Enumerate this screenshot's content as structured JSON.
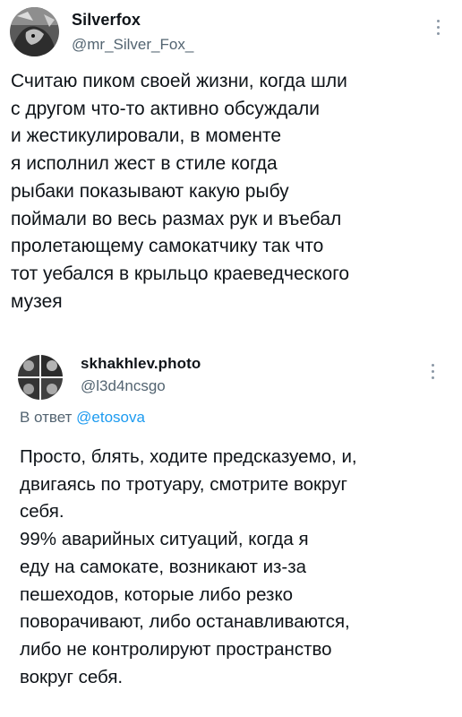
{
  "main_tweet": {
    "author_name": "Silverfox",
    "author_handle": "@mr_Silver_Fox_",
    "text": "Считаю пиком своей жизни, когда шли\nс другом что-то активно обсуждали\nи жестикулировали, в моменте\nя исполнил жест в стиле когда\nрыбаки показывают какую рыбу\nпоймали во весь размах рук и въебал\nпролетающему самокатчику так что\nтот уебался в крыльцо краеведческого\nмузея"
  },
  "quoted_tweet": {
    "author_name": "skhakhlev.photo",
    "author_handle": "@l3d4ncsgo",
    "reply_prefix": "В ответ ",
    "reply_mention": "@etosova",
    "text": "Просто, блять, ходите предсказуемо, и,\nдвигаясь по тротуару, смотрите вокруг\nсебя.\n99% аварийных ситуаций, когда я\nеду на самокате, возникают из-за\nпешеходов, которые либо резко\nповорачивают, либо останавливаются,\nлибо не контролируют пространство\nвокруг себя."
  },
  "colors": {
    "text_primary": "#0f1419",
    "text_secondary": "#536471",
    "accent": "#1d9bf0"
  },
  "icons": {
    "more": "more-vertical-icon"
  }
}
